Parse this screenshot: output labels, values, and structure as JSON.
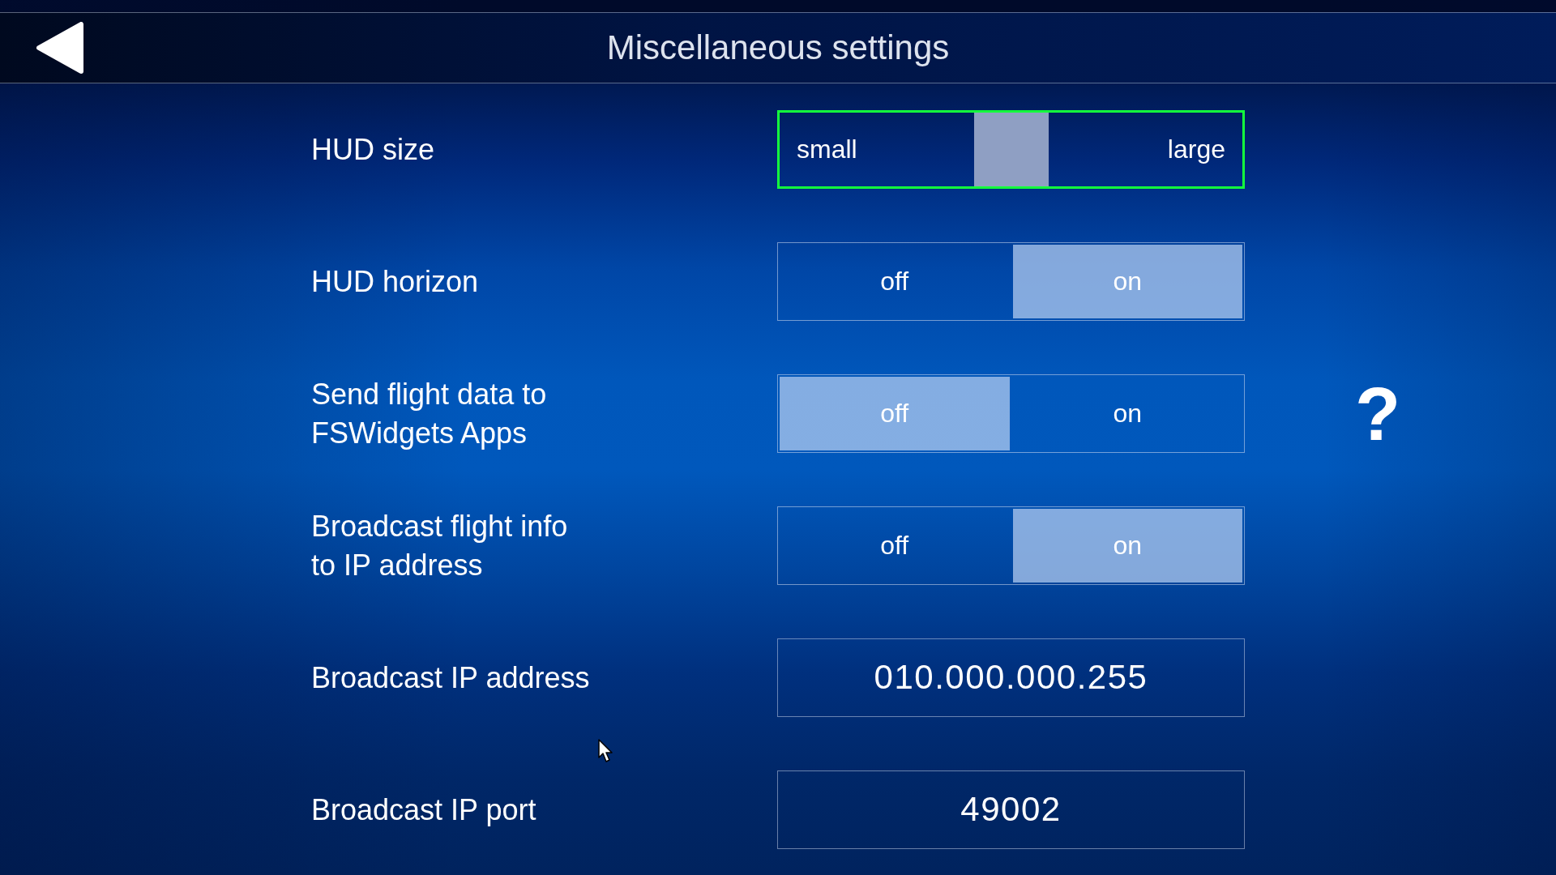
{
  "header": {
    "title": "Miscellaneous settings"
  },
  "settings": [
    {
      "kind": "slider",
      "label": "HUD size",
      "min_label": "small",
      "max_label": "large",
      "level": 0.5,
      "focused": true
    },
    {
      "kind": "toggle",
      "label": "HUD horizon",
      "options": [
        {
          "label": "off",
          "selected": false
        },
        {
          "label": "on",
          "selected": true
        }
      ]
    },
    {
      "kind": "toggle",
      "label": "Send flight data to\nFSWidgets Apps",
      "options": [
        {
          "label": "off",
          "selected": true
        },
        {
          "label": "on",
          "selected": false
        }
      ],
      "help": "?"
    },
    {
      "kind": "toggle",
      "label": "Broadcast flight info\nto IP address",
      "options": [
        {
          "label": "off",
          "selected": false
        },
        {
          "label": "on",
          "selected": true
        }
      ]
    },
    {
      "kind": "field",
      "label": "Broadcast IP address",
      "value": "010.000.000.255"
    },
    {
      "kind": "field",
      "label": "Broadcast IP port",
      "value": "49002"
    }
  ]
}
